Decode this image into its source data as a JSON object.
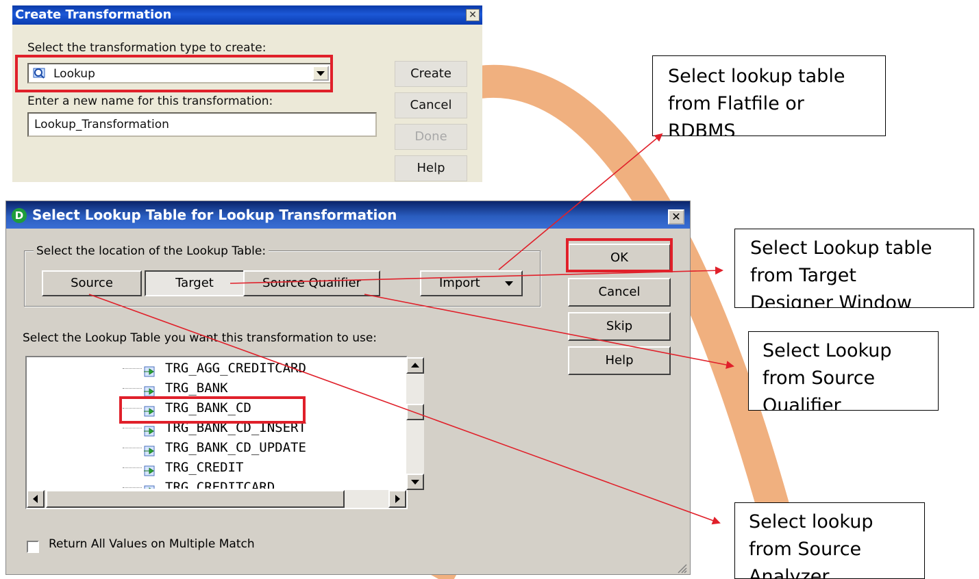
{
  "create_dialog": {
    "title": "Create Transformation",
    "close_glyph": "✕",
    "type_prompt": "Select the transformation type to create:",
    "type_value": "Lookup",
    "name_prompt": "Enter a new name for this transformation:",
    "name_value": "Lookup_Transformation",
    "buttons": {
      "create": "Create",
      "cancel": "Cancel",
      "done": "Done",
      "help": "Help"
    }
  },
  "lookup_dialog": {
    "title": "Select Lookup Table for Lookup Transformation",
    "logo_letter": "D",
    "close_glyph": "✕",
    "location_legend": "Select the location of the Lookup Table:",
    "location_buttons": {
      "source": "Source",
      "target": "Target",
      "source_qualifier": "Source Qualifier",
      "import": "Import"
    },
    "table_prompt": "Select the Lookup Table you want this transformation to use:",
    "tables": [
      "TRG_AGG_CREDITCARD",
      "TRG_BANK",
      "TRG_BANK_CD",
      "TRG_BANK_CD_INSERT",
      "TRG_BANK_CD_UPDATE",
      "TRG_CREDIT",
      "TRG_CREDITCARD"
    ],
    "selected_table": "TRG_BANK_CD",
    "checkbox_label": "Return All Values on Multiple Match",
    "buttons": {
      "ok": "OK",
      "cancel": "Cancel",
      "skip": "Skip",
      "help": "Help"
    }
  },
  "callouts": {
    "flatfile": [
      "Select lookup table",
      "from Flatfile or",
      "RDBMS"
    ],
    "target": [
      "Select Lookup table",
      "from Target",
      "Designer Window"
    ],
    "source_qualifier": [
      "Select Lookup",
      "from Source",
      "Qualifier"
    ],
    "source_analyzer": [
      "Select lookup",
      "from Source",
      "Analyzer"
    ]
  },
  "colors": {
    "highlight_red": "#e0202a",
    "arc_orange": "#f0b07f",
    "title_blue": "#0a3bb0"
  }
}
